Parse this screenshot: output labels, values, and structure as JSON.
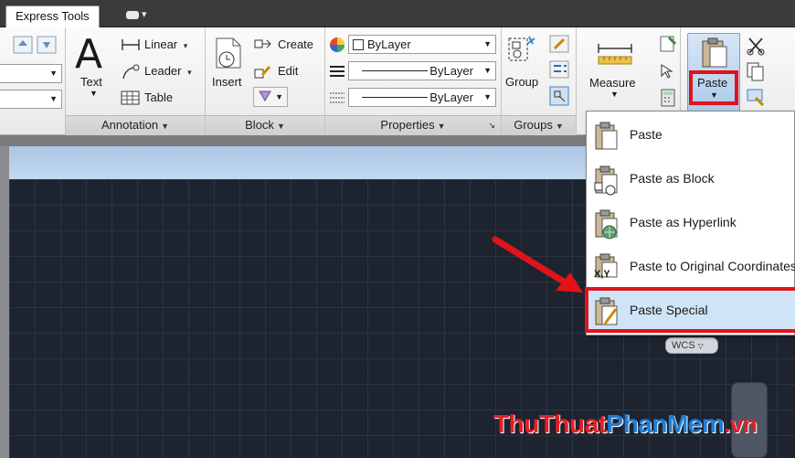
{
  "tabbar": {
    "tab": "Express Tools"
  },
  "annotation": {
    "title": "Annotation",
    "text_label": "Text",
    "linear_label": "Linear",
    "leader_label": "Leader",
    "table_label": "Table"
  },
  "block": {
    "title": "Block",
    "insert_label": "Insert",
    "create_label": "Create",
    "edit_label": "Edit"
  },
  "properties": {
    "title": "Properties",
    "color_value": "ByLayer",
    "linetype_value": "ByLayer",
    "lineweight_value": "ByLayer"
  },
  "groups": {
    "title": "Groups",
    "group_label": "Group"
  },
  "utilities": {
    "measure_label": "Measure"
  },
  "clipboard": {
    "paste_label": "Paste"
  },
  "menu": {
    "items": [
      {
        "label": "Paste"
      },
      {
        "label": "Paste as Block"
      },
      {
        "label": "Paste as Hyperlink"
      },
      {
        "label": "Paste to Original Coordinates"
      },
      {
        "label": "Paste Special"
      }
    ],
    "xy_text": "X,Y"
  },
  "viewport": {
    "wcs_label": "WCS"
  },
  "watermark": {
    "part1": "ThuThuat",
    "part2": "PhanMem",
    "part3": ".vn"
  },
  "colors": {
    "highlight_red": "#e0131b",
    "selection_blue": "#cfe4f7",
    "canvas": "#1d2430"
  }
}
